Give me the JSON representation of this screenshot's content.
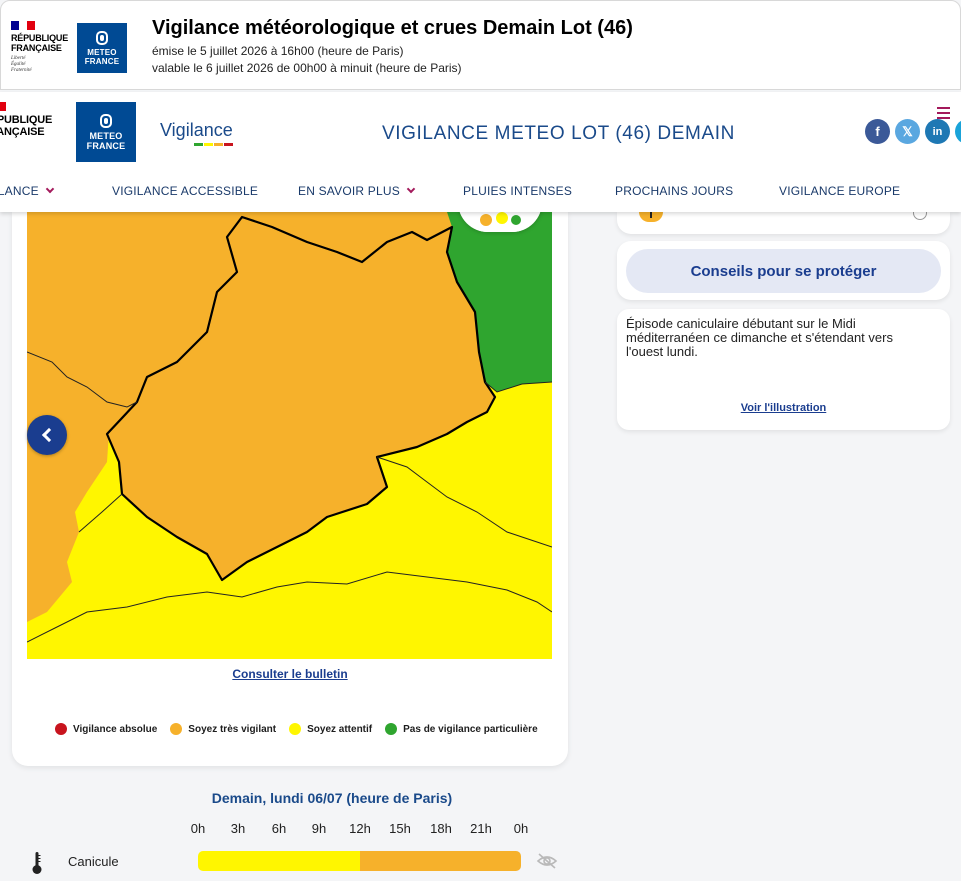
{
  "colors": {
    "absolute": "#c8141e",
    "very_vigilant": "#f6b12b",
    "attentive": "#fff600",
    "none": "#2fa52f",
    "brand_blue": "#004a94",
    "accent": "#a3195b"
  },
  "print_header": {
    "republique_lines": [
      "RÉPUBLIQUE",
      "FRANÇAISE"
    ],
    "motto": [
      "Liberté",
      "Égalité",
      "Fraternité"
    ],
    "meteo_lines": [
      "METEO",
      "FRANCE"
    ],
    "title": "Vigilance météorologique et crues Demain Lot (46)",
    "issued": "émise le 5 juillet 2026 à 16h00 (heure de Paris)",
    "valid": "valable le 6 juillet 2026 de 00h00 à minuit (heure de Paris)"
  },
  "site_header": {
    "republique_lines": [
      "RÉPUBLIQUE",
      "FRANÇAISE"
    ],
    "meteo_lines": [
      "METEO",
      "FRANCE"
    ],
    "vigilance_logo": "Vigilance",
    "title": "VIGILANCE METEO LOT (46) DEMAIN",
    "social": [
      {
        "name": "facebook-icon",
        "glyph": "f",
        "color": "#3b5998"
      },
      {
        "name": "x-twitter-icon",
        "glyph": "𝕏",
        "color": "#5aa7e0"
      },
      {
        "name": "linkedin-icon",
        "glyph": "in",
        "color": "#1e78b4"
      },
      {
        "name": "instagram-icon",
        "glyph": "◎",
        "color": "#1aa3d9"
      }
    ],
    "nav": [
      "VIGILANCE",
      "VIGILANCE ACCESSIBLE",
      "EN SAVOIR PLUS",
      "PLUIES INTENSES",
      "PROCHAINS JOURS",
      "VIGILANCE EUROPE"
    ]
  },
  "map": {
    "bulletin_link": "Consulter le bulletin",
    "legend": [
      {
        "label": "Vigilance absolue",
        "color": "#c8141e"
      },
      {
        "label": "Soyez très vigilant",
        "color": "#f6b12b"
      },
      {
        "label": "Soyez attentif",
        "color": "#fff600"
      },
      {
        "label": "Pas de vigilance particulière",
        "color": "#2fa52f"
      }
    ]
  },
  "side": {
    "advice_button": "Conseils pour se protéger",
    "description": "Épisode caniculaire débutant sur le Midi méditerranéen ce dimanche et s'étendant vers l'ouest lundi.",
    "illustration_link": "Voir l'illustration"
  },
  "timeline": {
    "title": "Demain, lundi 06/07 (heure de Paris)",
    "hours": [
      "0h",
      "3h",
      "6h",
      "9h",
      "12h",
      "15h",
      "18h",
      "21h",
      "0h"
    ],
    "rows": [
      {
        "label": "Canicule",
        "segments": [
          {
            "from_hour": 0,
            "to_hour": 12,
            "level": "Soyez attentif",
            "color": "#fff600"
          },
          {
            "from_hour": 12,
            "to_hour": 24,
            "level": "Soyez très vigilant",
            "color": "#f6b12b"
          }
        ]
      }
    ]
  }
}
